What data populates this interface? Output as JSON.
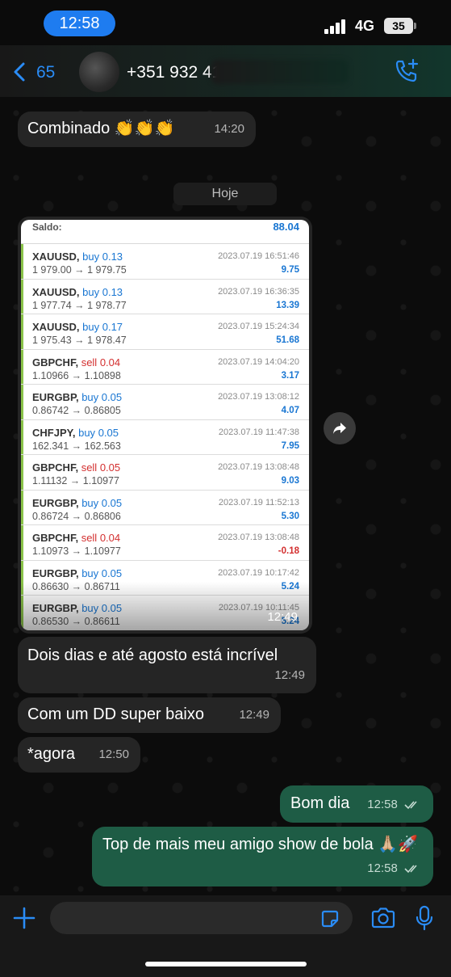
{
  "status_bar": {
    "time": "12:58",
    "network": "4G",
    "battery": "35"
  },
  "header": {
    "back_count": "65",
    "contact_name": "+351 932 41"
  },
  "day_separator": "Hoje",
  "messages": [
    {
      "text": "Combinado 👏👏👏",
      "time": "14:20",
      "direction": "incoming"
    },
    {
      "text": "Dois dias e até agosto está incrível",
      "time": "12:49",
      "direction": "incoming"
    },
    {
      "text": "Com um DD super baixo",
      "time": "12:49",
      "direction": "incoming"
    },
    {
      "text": "*agora",
      "time": "12:50",
      "direction": "incoming"
    },
    {
      "text": "Bom dia",
      "time": "12:58",
      "direction": "outgoing"
    },
    {
      "text": "Top de mais meu amigo show de bola 🙏🏼🚀",
      "time": "12:58",
      "direction": "outgoing"
    }
  ],
  "image_message": {
    "time": "12:49",
    "saldo_label": "Saldo:",
    "saldo_value": "88.04",
    "trades": [
      {
        "symbol": "XAUUSD,",
        "side": "buy",
        "volume": "0.13",
        "prices": "1 979.00 → 1 979.75",
        "date": "2023.07.19 16:51:46",
        "profit": "9.75"
      },
      {
        "symbol": "XAUUSD,",
        "side": "buy",
        "volume": "0.13",
        "prices": "1 977.74 → 1 978.77",
        "date": "2023.07.19 16:36:35",
        "profit": "13.39"
      },
      {
        "symbol": "XAUUSD,",
        "side": "buy",
        "volume": "0.17",
        "prices": "1 975.43 → 1 978.47",
        "date": "2023.07.19 15:24:34",
        "profit": "51.68"
      },
      {
        "symbol": "GBPCHF,",
        "side": "sell",
        "volume": "0.04",
        "prices": "1.10966 → 1.10898",
        "date": "2023.07.19 14:04:20",
        "profit": "3.17"
      },
      {
        "symbol": "EURGBP,",
        "side": "buy",
        "volume": "0.05",
        "prices": "0.86742 → 0.86805",
        "date": "2023.07.19 13:08:12",
        "profit": "4.07"
      },
      {
        "symbol": "CHFJPY,",
        "side": "buy",
        "volume": "0.05",
        "prices": "162.341 → 162.563",
        "date": "2023.07.19 11:47:38",
        "profit": "7.95"
      },
      {
        "symbol": "GBPCHF,",
        "side": "sell",
        "volume": "0.05",
        "prices": "1.11132 → 1.10977",
        "date": "2023.07.19 13:08:48",
        "profit": "9.03"
      },
      {
        "symbol": "EURGBP,",
        "side": "buy",
        "volume": "0.05",
        "prices": "0.86724 → 0.86806",
        "date": "2023.07.19 11:52:13",
        "profit": "5.30"
      },
      {
        "symbol": "GBPCHF,",
        "side": "sell",
        "volume": "0.04",
        "prices": "1.10973 → 1.10977",
        "date": "2023.07.19 13:08:48",
        "profit": "-0.18"
      },
      {
        "symbol": "EURGBP,",
        "side": "buy",
        "volume": "0.05",
        "prices": "0.86630 → 0.86711",
        "date": "2023.07.19 10:17:42",
        "profit": "5.24"
      },
      {
        "symbol": "EURGBP,",
        "side": "buy",
        "volume": "0.05",
        "prices": "0.86530 → 0.86611",
        "date": "2023.07.19 10:11:45",
        "profit": "5.24"
      }
    ]
  },
  "input": {
    "placeholder": ""
  },
  "colors": {
    "accent": "#1e7cf0",
    "outgoing_bubble": "#1e5c45",
    "incoming_bubble": "#252525",
    "buy": "#1976d2",
    "sell": "#d32f2f"
  },
  "icons": [
    "back-chevron-icon",
    "add-call-icon",
    "forward-icon",
    "plus-icon",
    "sticker-icon",
    "camera-icon",
    "mic-icon"
  ]
}
